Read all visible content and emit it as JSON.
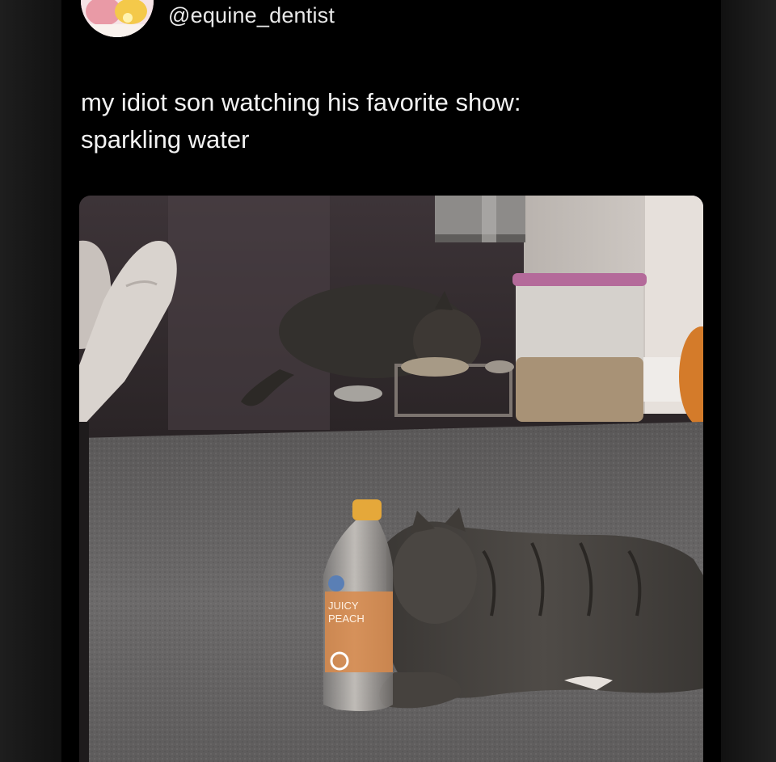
{
  "tweet": {
    "username": "@equine_dentist",
    "text_line_1": "my idiot son watching his favorite show:",
    "text_line_2": "sparkling water"
  },
  "photo": {
    "bottle_label_line_1": "JUICY",
    "bottle_label_line_2": "PEACH"
  },
  "colors": {
    "background": "#000000",
    "text": "#f2f2f2",
    "username": "#e8e8e8"
  }
}
